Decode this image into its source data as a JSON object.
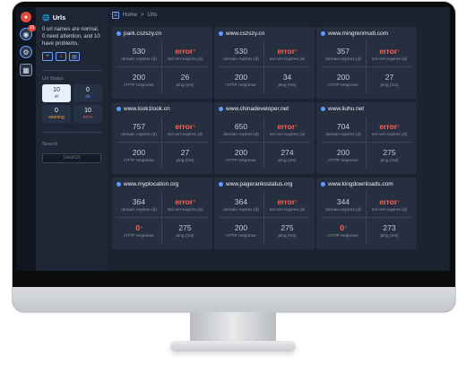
{
  "sidebar": {
    "badge_count": "10",
    "title": "Urls",
    "summary": "0 url names are normal, 0 need attention, and 10 have problems.",
    "status_section_label": "Url Status",
    "stats": [
      {
        "count": "10",
        "label": "all"
      },
      {
        "count": "0",
        "label": "ok"
      },
      {
        "count": "0",
        "label": "warning"
      },
      {
        "count": "10",
        "label": "error"
      }
    ],
    "search_label": "Search",
    "search_placeholder": "Search"
  },
  "breadcrumb": {
    "home": "Home",
    "sep": ">",
    "current": "Urls"
  },
  "metric_labels": {
    "domain_expires": "domain expires (d)",
    "ssl_expires": "ssl cert expires (d)",
    "http_response": "HTTP response",
    "ping": "ping (ms)"
  },
  "error_text": "error",
  "alert_mark": "!",
  "cards": [
    {
      "name": "park.cszszy.cn",
      "domain_expires": "530",
      "ssl": "error",
      "http": "200",
      "ping": "26"
    },
    {
      "name": "www.cszszy.cn",
      "domain_expires": "530",
      "ssl": "error",
      "http": "200",
      "ping": "34"
    },
    {
      "name": "www.mingrenmudi.com",
      "domain_expires": "357",
      "ssl": "error",
      "http": "200",
      "ping": "27"
    },
    {
      "name": "www.look1look.cn",
      "domain_expires": "757",
      "ssl": "error",
      "http": "200",
      "ping": "27"
    },
    {
      "name": "www.chinadeveloper.net",
      "domain_expires": "650",
      "ssl": "error",
      "http": "200",
      "ping": "274"
    },
    {
      "name": "www.liuhu.net",
      "domain_expires": "704",
      "ssl": "error",
      "http": "200",
      "ping": "275"
    },
    {
      "name": "www.myplocation.org",
      "domain_expires": "364",
      "ssl": "error",
      "http": "0",
      "ping": "275"
    },
    {
      "name": "www.pageranksstatus.org",
      "domain_expires": "364",
      "ssl": "error",
      "http": "200",
      "ping": "275"
    },
    {
      "name": "www.kingdownloads.com",
      "domain_expires": "344",
      "ssl": "error",
      "http": "0",
      "ping": "273"
    }
  ]
}
